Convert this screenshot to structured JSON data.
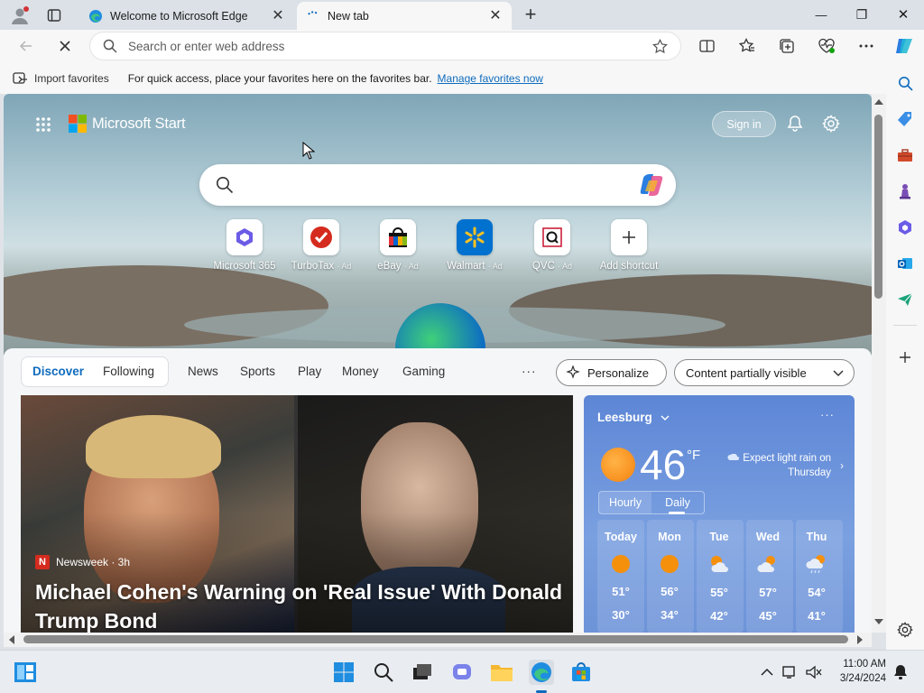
{
  "tabs": [
    {
      "title": "Welcome to Microsoft Edge",
      "close": "✕"
    },
    {
      "title": "New tab",
      "close": "✕"
    }
  ],
  "new_tab_symbol": "+",
  "window_controls": {
    "minimize": "—",
    "restore": "❐",
    "close": "✕"
  },
  "address": {
    "placeholder": "Search or enter web address"
  },
  "favorites_bar": {
    "import_label": "Import favorites",
    "hint": "For quick access, place your favorites here on the favorites bar.",
    "manage_link": "Manage favorites now"
  },
  "start": {
    "brand": "Microsoft Start",
    "sign_in": "Sign in",
    "shortcuts": [
      {
        "label": "Microsoft 365",
        "ad": ""
      },
      {
        "label": "TurboTax",
        "ad": "· Ad"
      },
      {
        "label": "eBay",
        "ad": "· Ad"
      },
      {
        "label": "Walmart",
        "ad": "· Ad"
      },
      {
        "label": "QVC",
        "ad": "· Ad"
      },
      {
        "label": "Add shortcut",
        "ad": ""
      }
    ]
  },
  "feed": {
    "tabs": [
      "Discover",
      "Following",
      "News",
      "Sports",
      "Play",
      "Money",
      "Gaming"
    ],
    "more": "···",
    "personalize": "Personalize",
    "visibility": "Content partially visible",
    "story": {
      "source": "Newsweek · 3h",
      "headline": "Michael Cohen's Warning on 'Real Issue' With Donald Trump Bond"
    }
  },
  "weather": {
    "location": "Leesburg",
    "temp": "46",
    "unit": "°F",
    "forecast_note": "Expect light rain on Thursday",
    "modes": [
      "Hourly",
      "Daily"
    ],
    "more": "···",
    "days": [
      {
        "name": "Today",
        "hi": "51°",
        "lo": "30°",
        "icon": "sun"
      },
      {
        "name": "Mon",
        "hi": "56°",
        "lo": "34°",
        "icon": "sun"
      },
      {
        "name": "Tue",
        "hi": "55°",
        "lo": "42°",
        "icon": "partly-cloudy"
      },
      {
        "name": "Wed",
        "hi": "57°",
        "lo": "45°",
        "icon": "cloudy"
      },
      {
        "name": "Thu",
        "hi": "54°",
        "lo": "41°",
        "icon": "rain"
      }
    ]
  },
  "clock": {
    "time": "11:00 AM",
    "date": "3/24/2024"
  },
  "colors": {
    "accent": "#0f6cbd",
    "link": "#0f6cbd",
    "weather_bg": "#6d93d8"
  }
}
